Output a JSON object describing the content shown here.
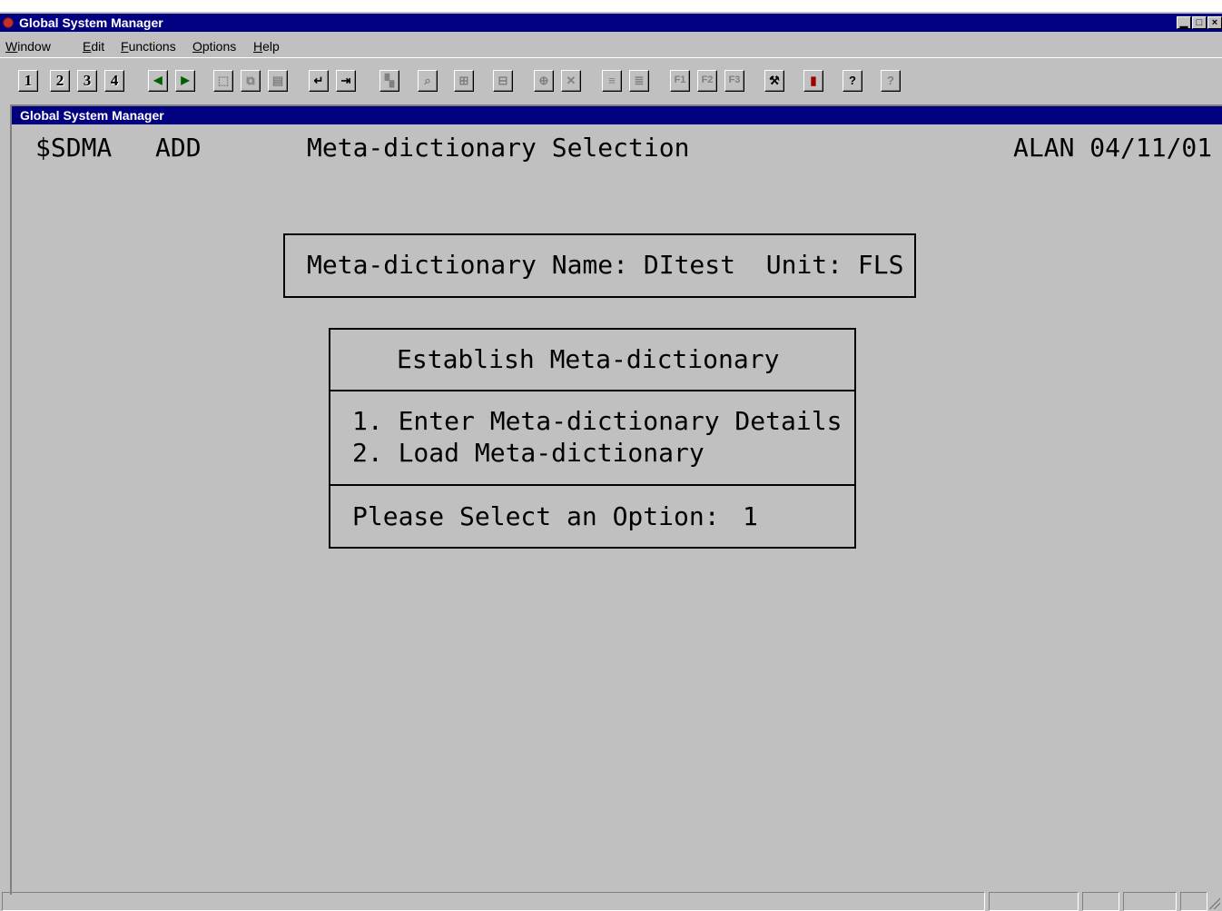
{
  "window": {
    "title": "Global System Manager",
    "controls": {
      "minimize": "▁",
      "maximize": "□",
      "close": "×"
    }
  },
  "menu": {
    "window": {
      "acc": "W",
      "rest": "indow"
    },
    "edit": {
      "acc": "E",
      "rest": "dit"
    },
    "functions": {
      "acc": "F",
      "rest": "unctions"
    },
    "options": {
      "acc": "O",
      "rest": "ptions"
    },
    "help": {
      "acc": "H",
      "rest": "elp"
    }
  },
  "toolbar": {
    "b1": "1",
    "b2": "2",
    "b3": "3",
    "b4": "4",
    "prev": "◀",
    "next": "▶",
    "select": "⬚",
    "copy": "⧉",
    "paste": "▤",
    "enter": "↵",
    "exit": "⇥",
    "t1": "▚",
    "find": "⌕",
    "t2": "⊞",
    "t3": "⊟",
    "t4": "⊕",
    "delete": "✕",
    "t5": "≡",
    "t6": "≣",
    "f1": "F1",
    "f2": "F2",
    "f3": "F3",
    "tools": "⚒",
    "chart": "▮",
    "help": "?",
    "context_help": "?"
  },
  "child_window": {
    "title": "Global System Manager"
  },
  "screen": {
    "program": "$SDMA",
    "mode": "ADD",
    "heading": "Meta-dictionary Selection",
    "user_date": "ALAN 04/11/01",
    "name_line": "Meta-dictionary Name: DItest  Unit: FLS",
    "menu_title": "Establish Meta-dictionary",
    "option1": "1. Enter Meta-dictionary Details",
    "option2": "2. Load Meta-dictionary",
    "prompt": "Please Select an Option:",
    "selected_option": "1"
  },
  "colors": {
    "titlebar": "#000080",
    "background": "#c0c0c0",
    "close_icon": "#c03030"
  }
}
